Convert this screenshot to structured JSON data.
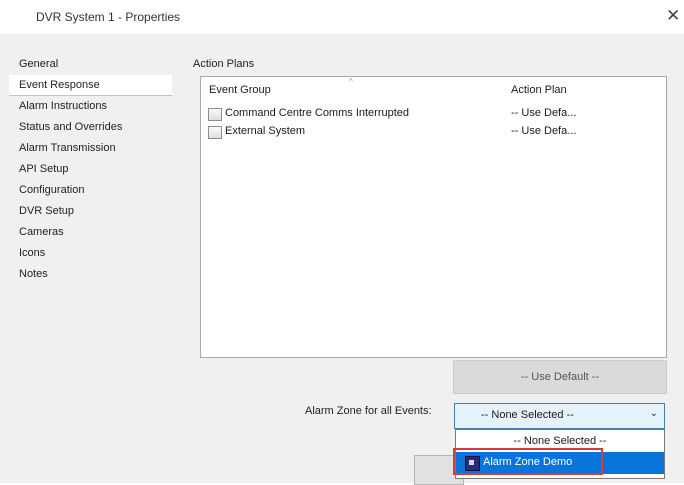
{
  "window": {
    "title": "DVR System 1 - Properties",
    "close_glyph": "✕"
  },
  "sidebar": {
    "items": [
      {
        "label": "General"
      },
      {
        "label": "Event Response"
      },
      {
        "label": "Alarm Instructions"
      },
      {
        "label": "Status and Overrides"
      },
      {
        "label": "Alarm Transmission"
      },
      {
        "label": "API Setup"
      },
      {
        "label": "Configuration"
      },
      {
        "label": "DVR Setup"
      },
      {
        "label": "Cameras"
      },
      {
        "label": "Icons"
      },
      {
        "label": "Notes"
      }
    ]
  },
  "action_plans": {
    "group_label": "Action Plans",
    "columns": [
      "Event Group",
      "Action Plan"
    ],
    "rows": [
      {
        "event_group": "Command Centre Comms Interrupted",
        "action_plan": "-- Use Defa..."
      },
      {
        "event_group": "External System",
        "action_plan": "-- Use Defa..."
      }
    ],
    "use_default_button": "-- Use Default --"
  },
  "alarm_zone": {
    "label": "Alarm Zone for all Events:",
    "selected": "-- None Selected --",
    "options": [
      "-- None Selected --",
      "Alarm Zone Demo"
    ],
    "highlighted_option": "Alarm Zone Demo"
  },
  "colors": {
    "accent": "#0a74da",
    "highlight_border": "#d93a3a"
  }
}
